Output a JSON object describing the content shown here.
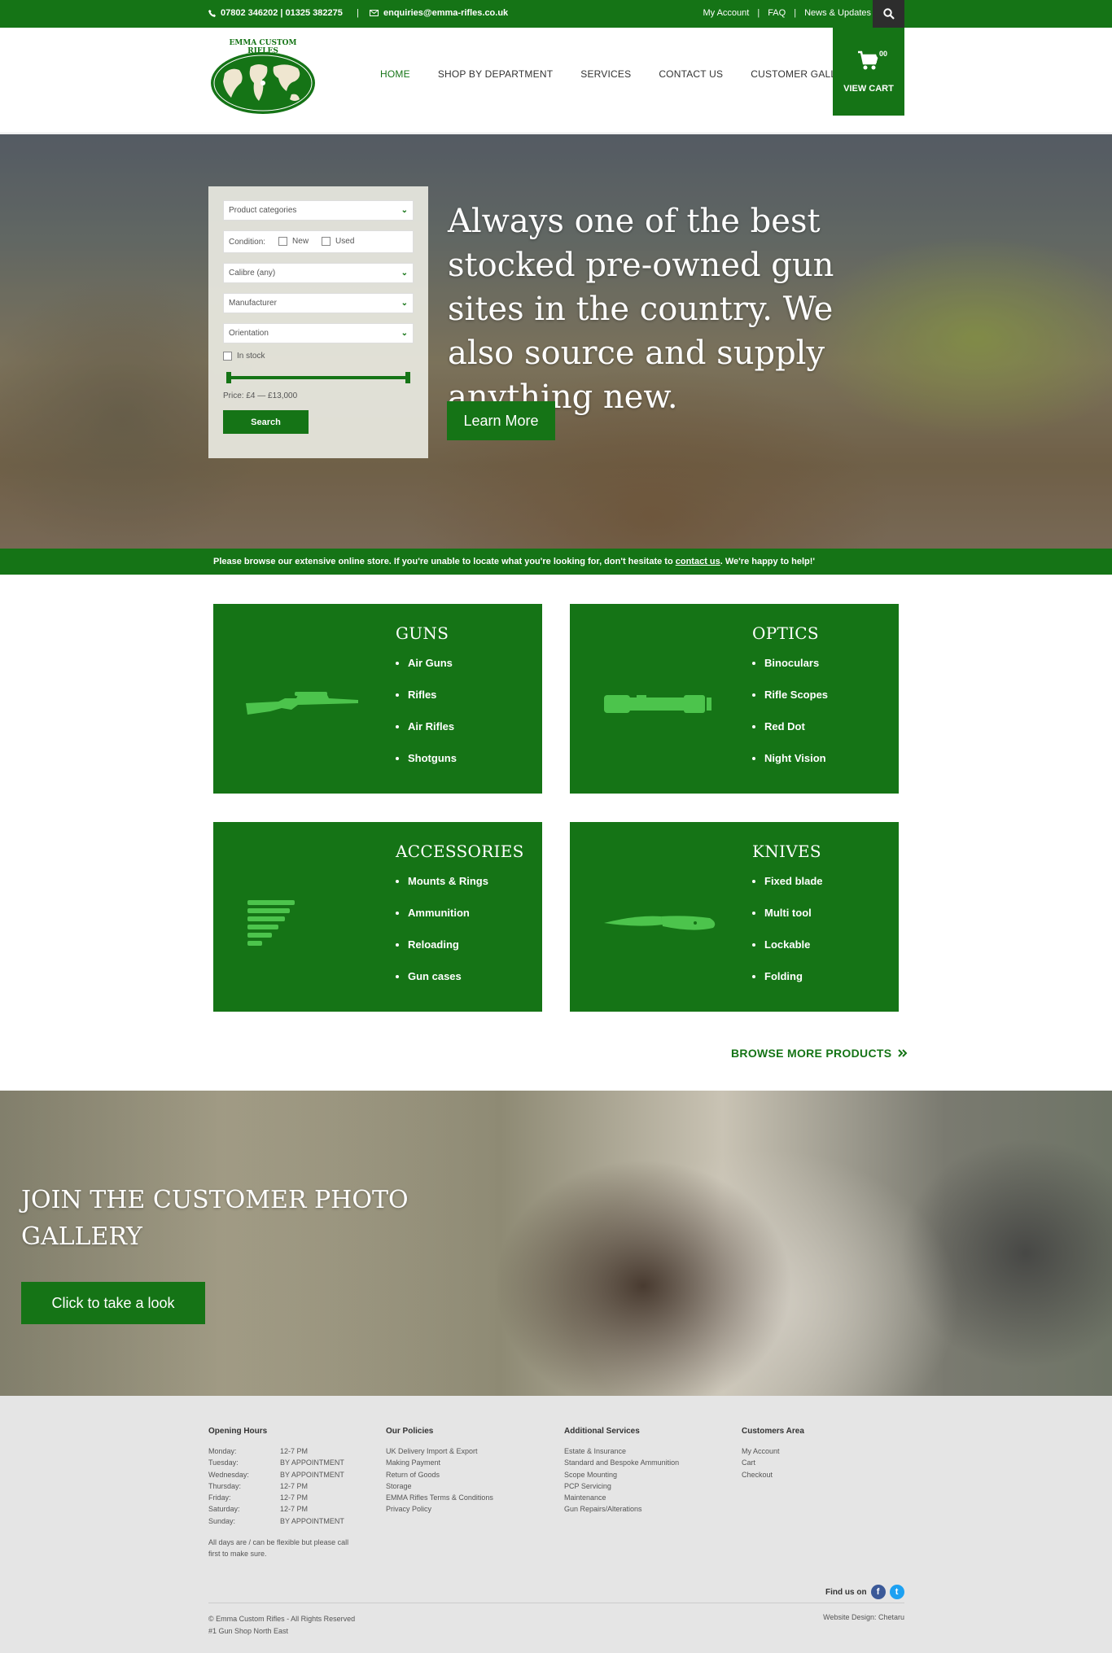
{
  "topbar": {
    "phone": "07802 346202 | 01325 382275",
    "separator": "|",
    "email": "enquiries@emma-rifles.co.uk",
    "links": [
      "My Account",
      "FAQ",
      "News & Updates"
    ]
  },
  "header": {
    "logo_text": "EMMA CUSTOM RIFLES",
    "nav": [
      "HOME",
      "SHOP BY DEPARTMENT",
      "SERVICES",
      "CONTACT US",
      "CUSTOMER GALLERY"
    ],
    "cart_count": "00",
    "cart_label": "VIEW CART"
  },
  "filter": {
    "categories": "Product categories",
    "condition_label": "Condition:",
    "condition_new": "New",
    "condition_used": "Used",
    "calibre": "Calibre (any)",
    "manufacturer": "Manufacturer",
    "orientation": "Orientation",
    "in_stock": "In stock",
    "price": "Price: £4 — £13,000",
    "search": "Search"
  },
  "hero": {
    "headline": "Always one of the best stocked pre-owned gun sites in the country. We also source and supply anything new.",
    "button": "Learn More"
  },
  "browse_bar": {
    "before": "Please browse our extensive online store. If you're unable to locate what you're looking for, don't hesitate to ",
    "link": "contact us",
    "after": ". We're happy to help!'"
  },
  "categories": [
    {
      "title": "GUNS",
      "items": [
        "Air Guns",
        "Rifles",
        "Air Rifles",
        "Shotguns"
      ],
      "icon": "rifle-icon"
    },
    {
      "title": "OPTICS",
      "items": [
        "Binoculars",
        "Rifle Scopes",
        "Red Dot",
        "Night Vision"
      ],
      "icon": "scope-icon"
    },
    {
      "title": "ACCESSORIES",
      "items": [
        "Mounts & Rings",
        "Ammunition",
        "Reloading",
        "Gun cases"
      ],
      "icon": "ammunition-icon"
    },
    {
      "title": "KNIVES",
      "items": [
        "Fixed blade",
        "Multi tool",
        "Lockable",
        "Folding"
      ],
      "icon": "knife-icon"
    }
  ],
  "browse_more": "BROWSE MORE PRODUCTS",
  "gallery": {
    "title": "JOIN THE CUSTOMER PHOTO GALLERY",
    "button": "Click to take a look"
  },
  "footer": {
    "hours_title": "Opening Hours",
    "hours": [
      {
        "day": "Monday:",
        "time": "12-7 PM"
      },
      {
        "day": "Tuesday:",
        "time": "BY APPOINTMENT"
      },
      {
        "day": "Wednesday:",
        "time": "BY APPOINTMENT"
      },
      {
        "day": "Thursday:",
        "time": "12-7 PM"
      },
      {
        "day": "Friday:",
        "time": "12-7 PM"
      },
      {
        "day": "Saturday:",
        "time": "12-7 PM"
      },
      {
        "day": "Sunday:",
        "time": "BY APPOINTMENT"
      }
    ],
    "hours_note": "All days are / can be flexible but please call first to make sure.",
    "policies_title": "Our Policies",
    "policies": [
      "UK Delivery Import & Export",
      "Making Payment",
      "Return of Goods",
      "Storage",
      "EMMA Rifles Terms & Conditions",
      "Privacy Policy"
    ],
    "services_title": "Additional Services",
    "services": [
      "Estate & Insurance",
      "Standard and Bespoke Ammunition",
      "Scope Mounting",
      "PCP Servicing",
      "Maintenance",
      "Gun Repairs/Alterations"
    ],
    "customers_title": "Customers Area",
    "customers": [
      "My Account",
      "Cart",
      "Checkout"
    ],
    "find_us": "Find us on",
    "copyright": "© Emma Custom Rifles - All Rights Reserved",
    "tagline": "#1 Gun Shop North East",
    "design": "Website Design: Chetaru"
  },
  "colors": {
    "brand_green": "#157416",
    "dark": "#2d2d2d",
    "facebook": "#3b5998",
    "twitter": "#1da1f2"
  }
}
